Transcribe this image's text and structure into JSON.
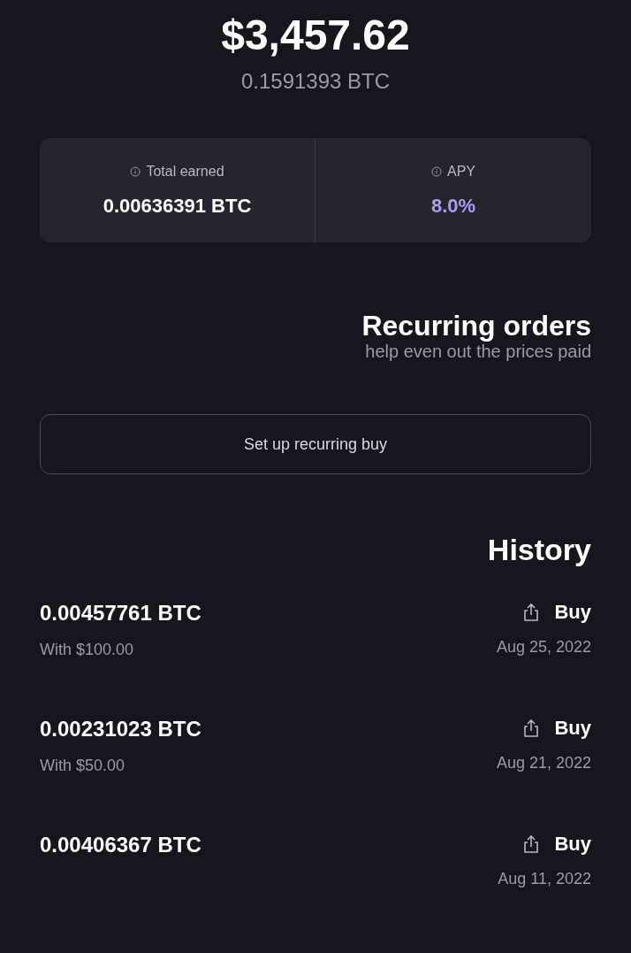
{
  "balance": {
    "fiat": "$3,457.62",
    "crypto": "0.1591393 BTC"
  },
  "stats": [
    {
      "label": "Total earned",
      "value": "0.00636391 BTC",
      "accent": false
    },
    {
      "label": "APY",
      "value": "8.0%",
      "accent": true
    }
  ],
  "recurring": {
    "title": "Recurring orders",
    "subtitle": "help even out the prices paid",
    "button": "Set up recurring buy"
  },
  "history": {
    "title": "History",
    "items": [
      {
        "type": "Buy",
        "date": "Aug 25, 2022",
        "amount": "0.00457761 BTC",
        "paid": "With $100.00"
      },
      {
        "type": "Buy",
        "date": "Aug 21, 2022",
        "amount": "0.00231023 BTC",
        "paid": "With $50.00"
      },
      {
        "type": "Buy",
        "date": "Aug 11, 2022",
        "amount": "0.00406367 BTC"
      }
    ]
  }
}
